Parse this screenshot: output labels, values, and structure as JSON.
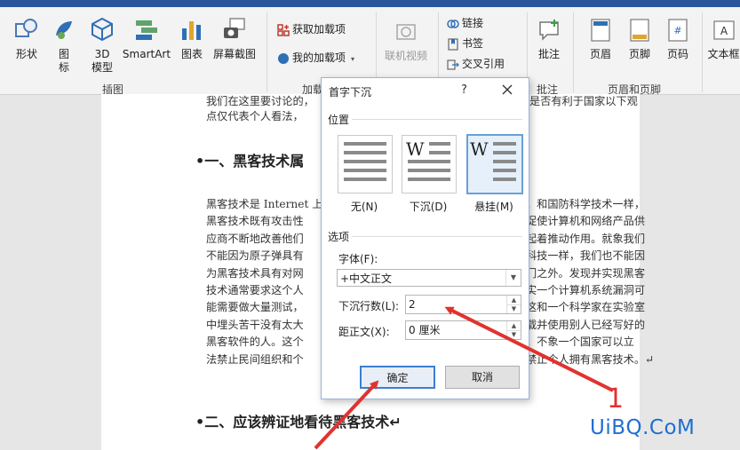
{
  "ribbon": {
    "shape": "形状",
    "icons": "图标",
    "model3d": "3D 模型",
    "smartart": "SmartArt",
    "chart": "图表",
    "screenshot": "屏幕截图",
    "group_illustrations": "插图",
    "get_addins": "获取加载项",
    "my_addins": "我的加载项",
    "online_video": "联机视频",
    "group_addins_partial": "加载",
    "link": "链接",
    "bookmark": "书签",
    "crossref": "交叉引用",
    "comment": "批注",
    "group_comment": "批注",
    "header": "页眉",
    "footer": "页脚",
    "pagenum": "页码",
    "group_header_footer": "页眉和页脚",
    "textbox": "文本框"
  },
  "document": {
    "lines_top": [
      "我们在这里要讨论的，",
      "点仅代表个人看法，"
    ],
    "right_top_fragment": "是否有利于国家以下观",
    "heading1": "一、黑客技术属",
    "para_left": [
      "黑客技术是 Internet 上",
      "黑客技术既有攻击性",
      "应商不断地改善他们",
      "不能因为原子弹具有",
      "为黑客技术具有对网",
      "技术通常要求这个人",
      "能需要做大量测试，",
      "中埋头苦干没有太大",
      "黑客软件的人。这个",
      "法禁止民间组织和个"
    ],
    "para_right": [
      "。和国防科学技术一样，",
      "促使计算机和网络产品供",
      "起着推动作用。就象我们",
      "科技一样，我们也不能因",
      "门之外。发现并实现黑客",
      "实一个计算机系统漏洞可",
      "这和一个科学家在实验室",
      "载并使用别人已经写好的",
      "。不象一个国家可以立",
      "禁止个人拥有黑客技术。↵"
    ],
    "heading2": "二、应该辨证地看待黑客技术↵"
  },
  "dialog": {
    "title": "首字下沉",
    "help": "?",
    "section_position": "位置",
    "opt_none": "无(N)",
    "opt_dropped": "下沉(D)",
    "opt_margin": "悬挂(M)",
    "section_options": "选项",
    "font_label": "字体(F):",
    "font_value": "+中文正文",
    "lines_label": "下沉行数(L):",
    "lines_value": "2",
    "distance_label": "距正文(X):",
    "distance_value": "0 厘米",
    "ok": "确定",
    "cancel": "取消"
  },
  "annotations": {
    "number": "1",
    "watermark": "UiBQ.CoM",
    "arrow_color": "#e0332f"
  }
}
